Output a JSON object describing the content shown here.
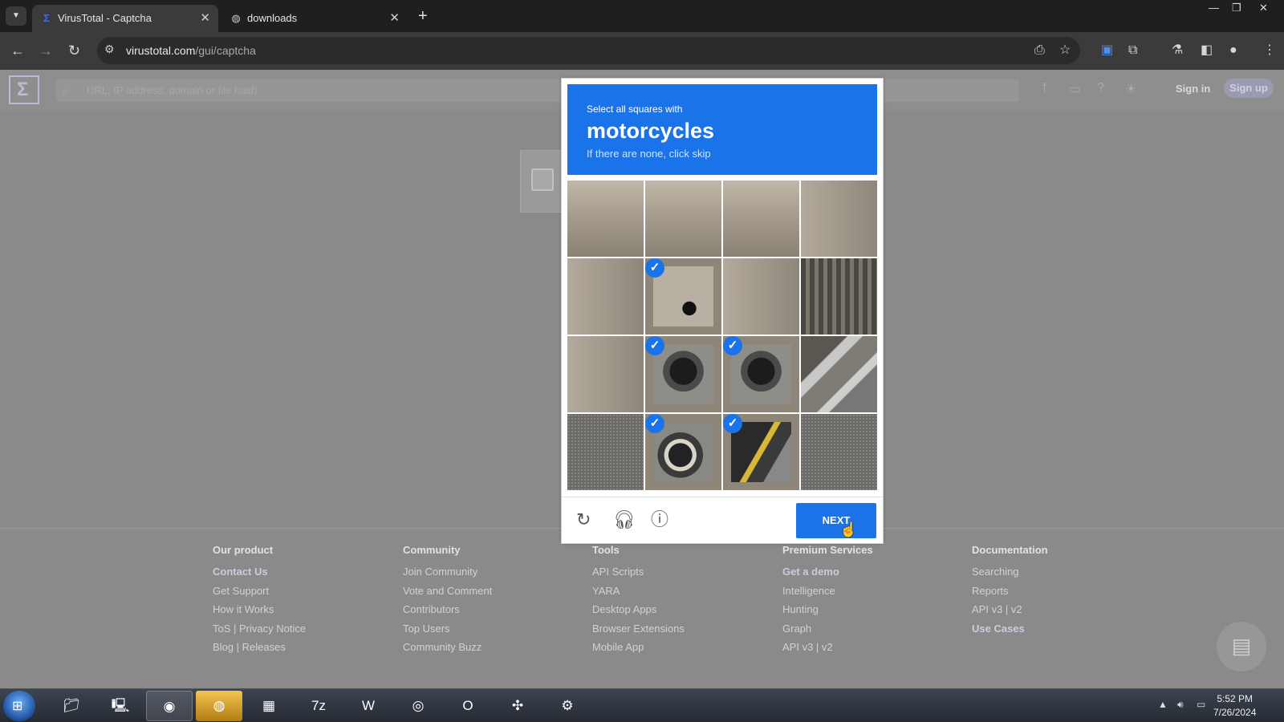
{
  "browser": {
    "tabs": [
      {
        "title": "VirusTotal - Captcha",
        "active": true
      },
      {
        "title": "downloads",
        "active": false
      }
    ],
    "url_host": "virustotal.com",
    "url_path": "/gui/captcha"
  },
  "vt": {
    "search_placeholder": "URL, IP address, domain or file hash",
    "sign_in": "Sign in",
    "sign_up": "Sign up"
  },
  "captcha": {
    "instruction": "Select all squares with",
    "target": "motorcycles",
    "hint": "If there are none, click skip",
    "next_label": "NEXT",
    "tiles": [
      {
        "style": "t-wall",
        "selected": false
      },
      {
        "style": "t-wall",
        "selected": false
      },
      {
        "style": "t-wall",
        "selected": false
      },
      {
        "style": "t-wall2",
        "selected": false
      },
      {
        "style": "t-wall2",
        "selected": false
      },
      {
        "style": "t-mirror",
        "selected": true
      },
      {
        "style": "t-wall2",
        "selected": false
      },
      {
        "style": "t-win",
        "selected": false
      },
      {
        "style": "t-wall2",
        "selected": false
      },
      {
        "style": "t-moto",
        "selected": true
      },
      {
        "style": "t-moto",
        "selected": true
      },
      {
        "style": "t-rail",
        "selected": false
      },
      {
        "style": "t-road",
        "selected": false
      },
      {
        "style": "t-moto2",
        "selected": true
      },
      {
        "style": "t-moto3",
        "selected": true
      },
      {
        "style": "t-road",
        "selected": false
      }
    ]
  },
  "footer": {
    "columns": [
      {
        "heading": "Our product",
        "links": [
          "Contact Us",
          "Get Support",
          "How it Works",
          "ToS | Privacy Notice",
          "Blog | Releases"
        ]
      },
      {
        "heading": "Community",
        "links": [
          "Join Community",
          "Vote and Comment",
          "Contributors",
          "Top Users",
          "Community Buzz"
        ]
      },
      {
        "heading": "Tools",
        "links": [
          "API Scripts",
          "YARA",
          "Desktop Apps",
          "Browser Extensions",
          "Mobile App"
        ]
      },
      {
        "heading": "Premium Services",
        "links": [
          "Get a demo",
          "Intelligence",
          "Hunting",
          "Graph",
          "API v3 | v2"
        ]
      },
      {
        "heading": "Documentation",
        "links": [
          "Searching",
          "Reports",
          "API v3 | v2",
          "Use Cases"
        ]
      }
    ]
  },
  "taskbar": {
    "time": "5:52 PM",
    "date": "7/26/2024"
  },
  "colors": {
    "accent": "#1a73e8"
  }
}
